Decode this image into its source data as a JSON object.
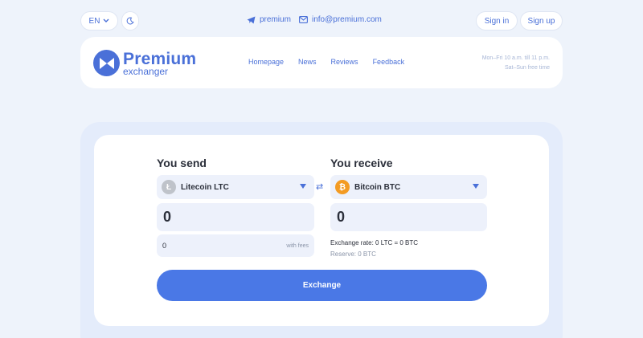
{
  "topbar": {
    "language": "EN",
    "telegram": "premium",
    "email": "info@premium.com",
    "signin": "Sign in",
    "signup": "Sign up"
  },
  "header": {
    "logo_main": "Premium",
    "logo_sub": "exchanger",
    "nav": [
      "Homepage",
      "News",
      "Reviews",
      "Feedback"
    ],
    "hours_weekday": "Mon–Fri 10 a.m. till 11 p.m.",
    "hours_weekend": "Sat–Sun free time"
  },
  "exchange": {
    "send_title": "You send",
    "receive_title": "You receive",
    "send_currency": "Litecoin LTC",
    "receive_currency": "Bitcoin BTC",
    "send_amount": "0",
    "receive_amount": "0",
    "fees_value": "0",
    "fees_note": "with fees",
    "rate": "Exchange rate: 0 LTC = 0 BTC",
    "reserve": "Reserve: 0 BTC",
    "button": "Exchange"
  },
  "colors": {
    "accent": "#4a70d8",
    "button": "#4a78e6",
    "background": "#eef3fb",
    "btc": "#f39b23",
    "ltc": "#bfc3ca"
  },
  "icons": {
    "language_chevron": "chevron-down-icon",
    "theme": "moon-icon",
    "telegram": "telegram-icon",
    "email": "mail-icon",
    "swap": "swap-arrows-icon",
    "ltc": "litecoin-icon",
    "btc": "bitcoin-icon"
  }
}
